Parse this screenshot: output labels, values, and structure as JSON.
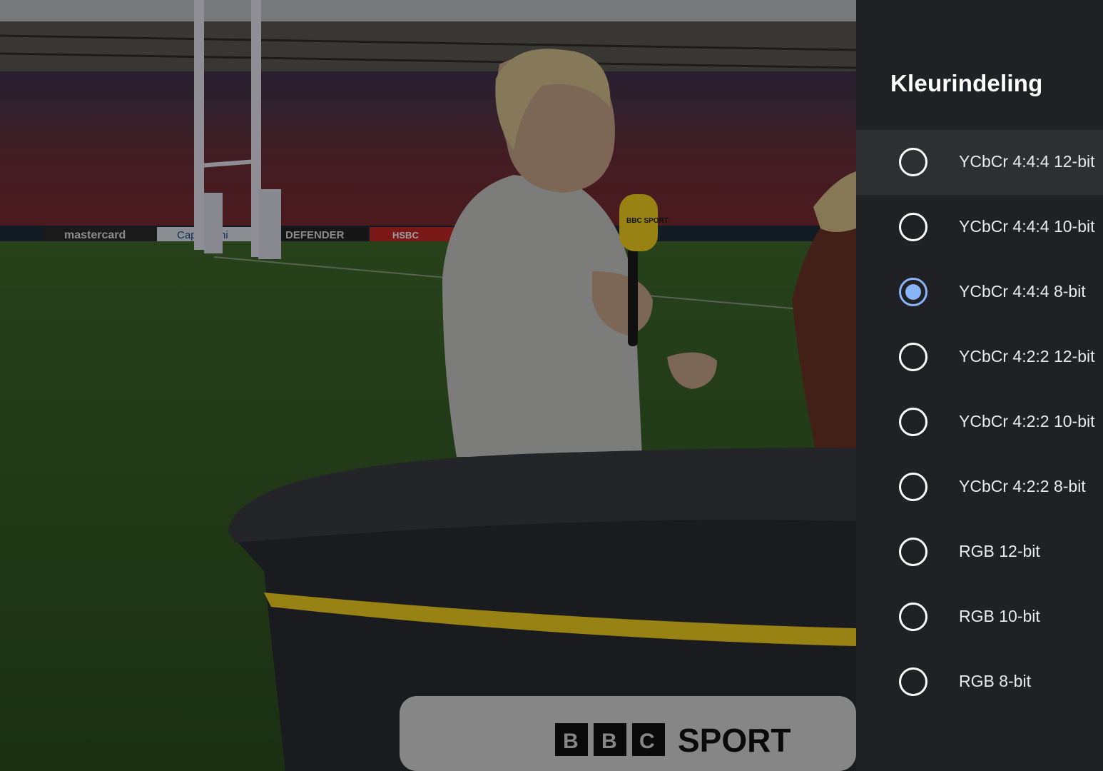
{
  "panel": {
    "title": "Kleurindeling",
    "options": [
      {
        "label": "YCbCr 4:4:4 12-bit",
        "selected": false,
        "focused": true
      },
      {
        "label": "YCbCr 4:4:4 10-bit",
        "selected": false,
        "focused": false
      },
      {
        "label": "YCbCr 4:4:4 8-bit",
        "selected": true,
        "focused": false
      },
      {
        "label": "YCbCr 4:2:2 12-bit",
        "selected": false,
        "focused": false
      },
      {
        "label": "YCbCr 4:2:2 10-bit",
        "selected": false,
        "focused": false
      },
      {
        "label": "YCbCr 4:2:2 8-bit",
        "selected": false,
        "focused": false
      },
      {
        "label": "RGB 12-bit",
        "selected": false,
        "focused": false
      },
      {
        "label": "RGB 10-bit",
        "selected": false,
        "focused": false
      },
      {
        "label": "RGB 8-bit",
        "selected": false,
        "focused": false
      }
    ]
  },
  "video": {
    "ad_boards": [
      "mastercard",
      "Capgemini",
      "DEFENDER",
      "HSBC"
    ],
    "mic_flag": "BBC SPORT",
    "desk_logo_letters": [
      "B",
      "B",
      "C"
    ],
    "desk_logo_word": "SPORT"
  },
  "colors": {
    "panel_bg": "#202124",
    "focused_row_bg": "#2e2f33",
    "accent": "#8ab4f8",
    "broadcast_yellow": "#f4d21f"
  }
}
